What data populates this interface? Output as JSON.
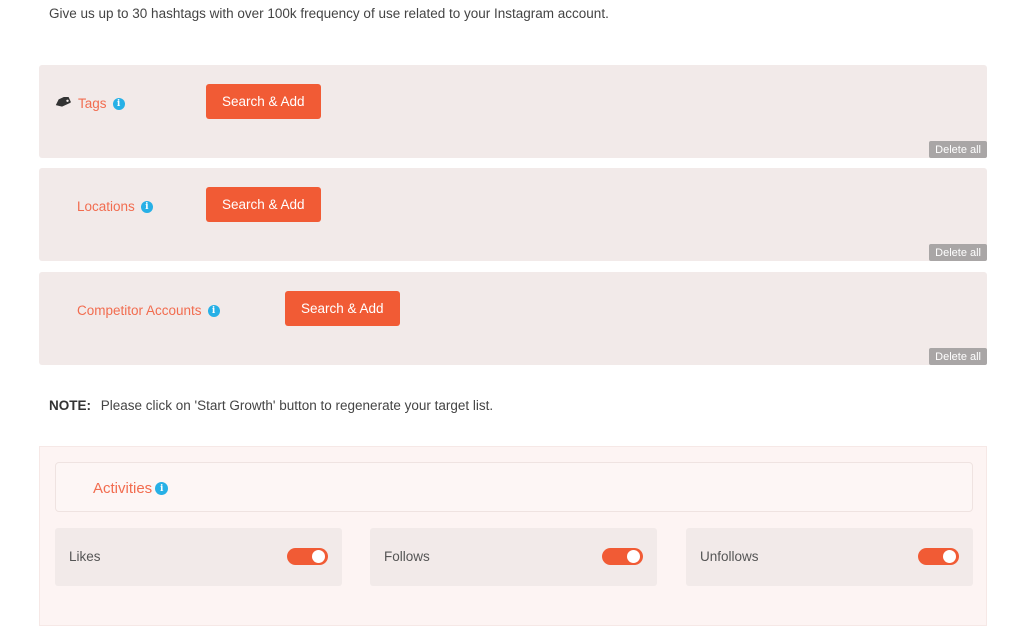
{
  "intro_text": "Give us up to 30 hashtags with over 100k frequency of use related to your Instagram account.",
  "sections": [
    {
      "label": "Tags",
      "icon": "tag-icon",
      "button": "Search & Add",
      "delete": "Delete all"
    },
    {
      "label": "Locations",
      "button": "Search & Add",
      "delete": "Delete all"
    },
    {
      "label": "Competitor Accounts",
      "button": "Search & Add",
      "delete": "Delete all"
    }
  ],
  "note": {
    "prefix": "NOTE:",
    "text": "Please click on 'Start Growth' button to regenerate your target list."
  },
  "activities": {
    "title": "Activities",
    "items": [
      {
        "label": "Likes",
        "enabled": true
      },
      {
        "label": "Follows",
        "enabled": true
      },
      {
        "label": "Unfollows",
        "enabled": true
      }
    ]
  },
  "info_glyph": "i",
  "colors": {
    "accent": "#f15b35",
    "label": "#f26c4f",
    "info": "#27b0e6",
    "panel": "#f2eae9",
    "delete": "#a9a6a6"
  }
}
